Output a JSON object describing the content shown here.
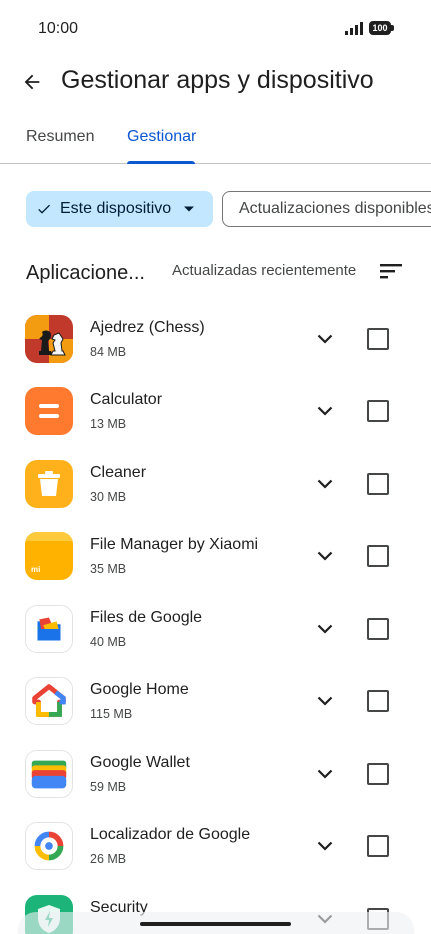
{
  "status": {
    "time": "10:00",
    "battery": "100"
  },
  "header": {
    "title": "Gestionar apps y dispositivo"
  },
  "tabs": [
    {
      "label": "Resumen"
    },
    {
      "label": "Gestionar"
    }
  ],
  "filters": {
    "device_chip": "Este dispositivo",
    "updates_chip": "Actualizaciones disponibles"
  },
  "section": {
    "title": "Aplicacione...",
    "sort_label": "Actualizadas recientemente"
  },
  "apps": [
    {
      "name": "Ajedrez (Chess)",
      "size": "84 MB"
    },
    {
      "name": "Calculator",
      "size": "13 MB"
    },
    {
      "name": "Cleaner",
      "size": "30 MB"
    },
    {
      "name": "File Manager by Xiaomi",
      "size": "35 MB"
    },
    {
      "name": "Files de Google",
      "size": "40 MB"
    },
    {
      "name": "Google Home",
      "size": "115 MB"
    },
    {
      "name": "Google Wallet",
      "size": "59 MB"
    },
    {
      "name": "Localizador de Google",
      "size": "26 MB"
    },
    {
      "name": "Security",
      "size": ""
    }
  ],
  "colors": {
    "accent": "#0b57d0",
    "chip_selected": "#c2e7ff"
  }
}
